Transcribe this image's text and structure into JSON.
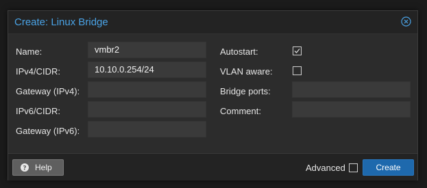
{
  "dialog": {
    "title": "Create: Linux Bridge",
    "title_color": "#4aa3e6",
    "close_icon": "close-circle-icon"
  },
  "left_fields": [
    {
      "label": "Name:",
      "value": "vmbr2"
    },
    {
      "label": "IPv4/CIDR:",
      "value": "10.10.0.254/24"
    },
    {
      "label": "Gateway (IPv4):",
      "value": ""
    },
    {
      "label": "IPv6/CIDR:",
      "value": ""
    },
    {
      "label": "Gateway (IPv6):",
      "value": ""
    }
  ],
  "right_fields": {
    "autostart": {
      "label": "Autostart:",
      "checked": true
    },
    "vlan_aware": {
      "label": "VLAN aware:",
      "checked": false
    },
    "bridge_ports": {
      "label": "Bridge ports:",
      "value": ""
    },
    "comment": {
      "label": "Comment:",
      "value": ""
    }
  },
  "footer": {
    "help_label": "Help",
    "help_icon": "question-circle-icon",
    "advanced_label": "Advanced",
    "advanced_checked": false,
    "create_label": "Create",
    "create_color": "#1e69ad"
  }
}
